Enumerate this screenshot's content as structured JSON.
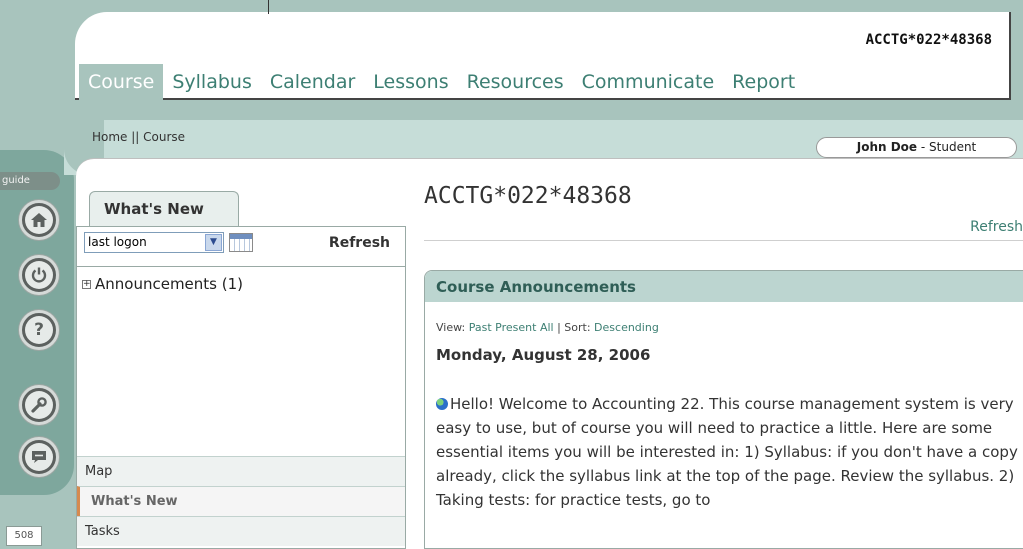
{
  "header": {
    "course_code": "ACCTG*022*48368",
    "nav": [
      "Course",
      "Syllabus",
      "Calendar",
      "Lessons",
      "Resources",
      "Communicate",
      "Report"
    ]
  },
  "breadcrumb": "Home || Course",
  "user": {
    "name": "John Doe",
    "role": " - Student"
  },
  "rail": {
    "guide_label": "guide",
    "buttons": [
      "home-icon",
      "power-icon",
      "help-icon",
      "wrench-icon",
      "chat-icon"
    ],
    "page_number": "508"
  },
  "whats_new": {
    "tab_label": "What's New",
    "select_value": "last logon",
    "refresh": "Refresh",
    "announcements_item": "Announcements (1)",
    "list": [
      "Map",
      "What's New",
      "Tasks"
    ]
  },
  "main": {
    "title": "ACCTG*022*48368",
    "refresh": "Refresh",
    "announcements": {
      "header": "Course Announcements",
      "view_prefix": "View:",
      "view_past": "Past",
      "view_present": "Present",
      "view_all": "All",
      "sort_prefix": "| Sort:",
      "sort_value": "Descending",
      "date": "Monday, August 28, 2006",
      "body": "Hello!  Welcome to Accounting 22. This course management system is very easy to use, but of course you will need to practice a little.  Here are some essential items you will be interested in:  1) Syllabus: if you don't have a copy already, click the syllabus link at the top of the page. Review the syllabus.  2) Taking tests: for practice tests, go to"
    }
  },
  "colors": {
    "accent": "#3d7f73",
    "band": "#a8c4bd",
    "light_band": "#c6ddd8",
    "header_fill": "#bcd5d0"
  }
}
